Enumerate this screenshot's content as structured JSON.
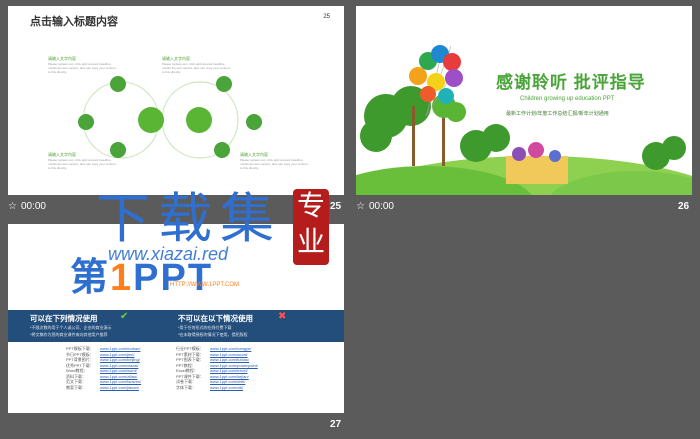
{
  "slides": [
    {
      "number": "25",
      "title": "点击输入标题内容",
      "textblocks": [
        {
          "heading": "请输入文字内容",
          "body": "Please replace text, click add relevant headline, modify the text content, also can copy your content to this directly."
        },
        {
          "heading": "请输入文字内容",
          "body": "Please replace text, click add relevant headline, modify the text content, also can copy your content to this directly."
        },
        {
          "heading": "请输入文字内容",
          "body": "Please replace text, click add relevant headline, modify the text content, also can copy your content to this directly."
        },
        {
          "heading": "请输入文字内容",
          "body": "Please replace text, click add relevant headline, modify the text content, also can copy your content to this directly."
        }
      ],
      "circles_center": [
        "请输入文字内容",
        "请输入文字内容"
      ],
      "circles_small": [
        "请输入文字内容",
        "请输入文字内容",
        "请输入文字内容",
        "请输入文字内容",
        "请输入文字内容",
        "请输入文字内容"
      ],
      "caption_time": "00:00",
      "caption_num": "25"
    },
    {
      "number": "26",
      "title": "感谢聆听 批评指导",
      "subtitle": "Children growing up education PPT",
      "subtitle2": "最新工作计划/年度工作总结汇报/新年计划通用",
      "caption_time": "00:00",
      "caption_num": "26"
    },
    {
      "number": "27",
      "logo_prefix": "第",
      "logo_one": "1",
      "logo_suffix": "PPT",
      "logo_url": "HTTP://WWW.1PPT.COM",
      "can_title": "可以在下列情况使用",
      "cannot_title": "不可以在以下情况使用",
      "can_lines": [
        "*不限次数的用于个人或公司、企业的商业演示",
        "*将文稿作为您的商业课件来向其他用户推荐"
      ],
      "cannot_lines": [
        "*用于任何形式的在线付费下载",
        "*在未取得授权的情况下使用，侵犯版权"
      ],
      "links_left": [
        {
          "label": "PPT模板下载：",
          "url": "www.1ppt.com/moban/"
        },
        {
          "label": "节日PPT模板：",
          "url": "www.1ppt.com/jieri/"
        },
        {
          "label": "PPT背景图片：",
          "url": "www.1ppt.com/beijing/"
        },
        {
          "label": "优秀PPT下载：",
          "url": "www.1ppt.com/xiazai/"
        },
        {
          "label": "Word教程：",
          "url": "www.1ppt.com/word/"
        },
        {
          "label": "资料下载：",
          "url": "www.1ppt.com/ziliao/"
        },
        {
          "label": "范文下载：",
          "url": "www.1ppt.com/fanwen/"
        },
        {
          "label": "教案下载：",
          "url": "www.1ppt.com/jiaoan/"
        }
      ],
      "links_right": [
        {
          "label": "行业PPT模板：",
          "url": "www.1ppt.com/hangye/"
        },
        {
          "label": "PPT素材下载：",
          "url": "www.1ppt.com/sucai/"
        },
        {
          "label": "PPT图表下载：",
          "url": "www.1ppt.com/tubiao/"
        },
        {
          "label": "PPT教程：",
          "url": "www.1ppt.com/powerpoint/"
        },
        {
          "label": "Excel教程：",
          "url": "www.1ppt.com/excel/"
        },
        {
          "label": "PPT课件下载：",
          "url": "www.1ppt.com/kejian/"
        },
        {
          "label": "试卷下载：",
          "url": "www.1ppt.com/shiti/"
        },
        {
          "label": "字体下载：",
          "url": "www.1ppt.com/ziti/"
        }
      ],
      "caption_num": "27"
    }
  ],
  "watermark": {
    "big": "下载集",
    "url": "www.xiazai.red",
    "seal": [
      "专",
      "业"
    ]
  },
  "colors": {
    "green": "#4aa43a",
    "blue_banner": "#234e7c",
    "red_seal": "#b51d1d",
    "bg": "#5b5b5b"
  }
}
